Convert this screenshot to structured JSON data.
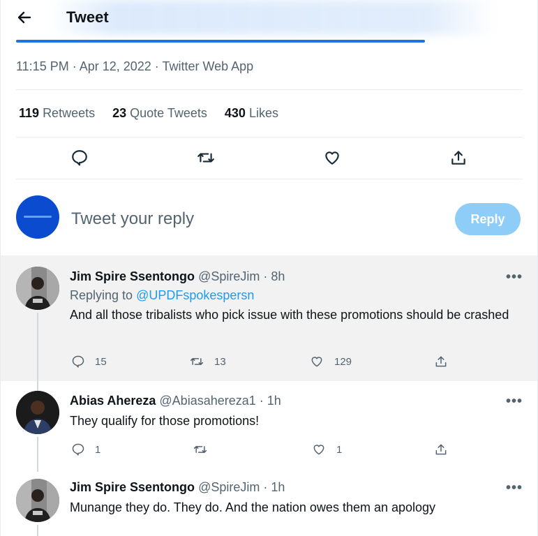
{
  "header": {
    "title": "Tweet"
  },
  "tweet": {
    "timestamp": "11:15 PM · Apr 12, 2022 · Twitter Web App",
    "stats": [
      {
        "count": "119",
        "label": "Retweets"
      },
      {
        "count": "23",
        "label": "Quote Tweets"
      },
      {
        "count": "430",
        "label": "Likes"
      }
    ]
  },
  "composer": {
    "placeholder": "Tweet your reply",
    "reply_label": "Reply"
  },
  "replies": [
    {
      "name": "Jim Spire Ssentongo",
      "handle": "@SpireJim · 8h",
      "replying_prefix": "Replying to ",
      "replying_to": "@UPDFspokespersn",
      "text": "And all those tribalists who pick issue with these promotions should be crashed",
      "replies": "15",
      "retweets": "13",
      "likes": "129"
    },
    {
      "name": "Abias Ahereza",
      "handle": "@Abiasahereza1 · 1h",
      "text": "They qualify for those promotions!",
      "replies": "1",
      "retweets": "",
      "likes": "1"
    },
    {
      "name": "Jim Spire Ssentongo",
      "handle": "@SpireJim · 1h",
      "text": "Munange they do. They do. And the nation owes them an apology"
    }
  ],
  "more_glyph": "•••",
  "colors": {
    "accent": "#1d9bf0",
    "reply_button": "#8ecdf7",
    "highlight_bg": "#f2f2f2"
  }
}
